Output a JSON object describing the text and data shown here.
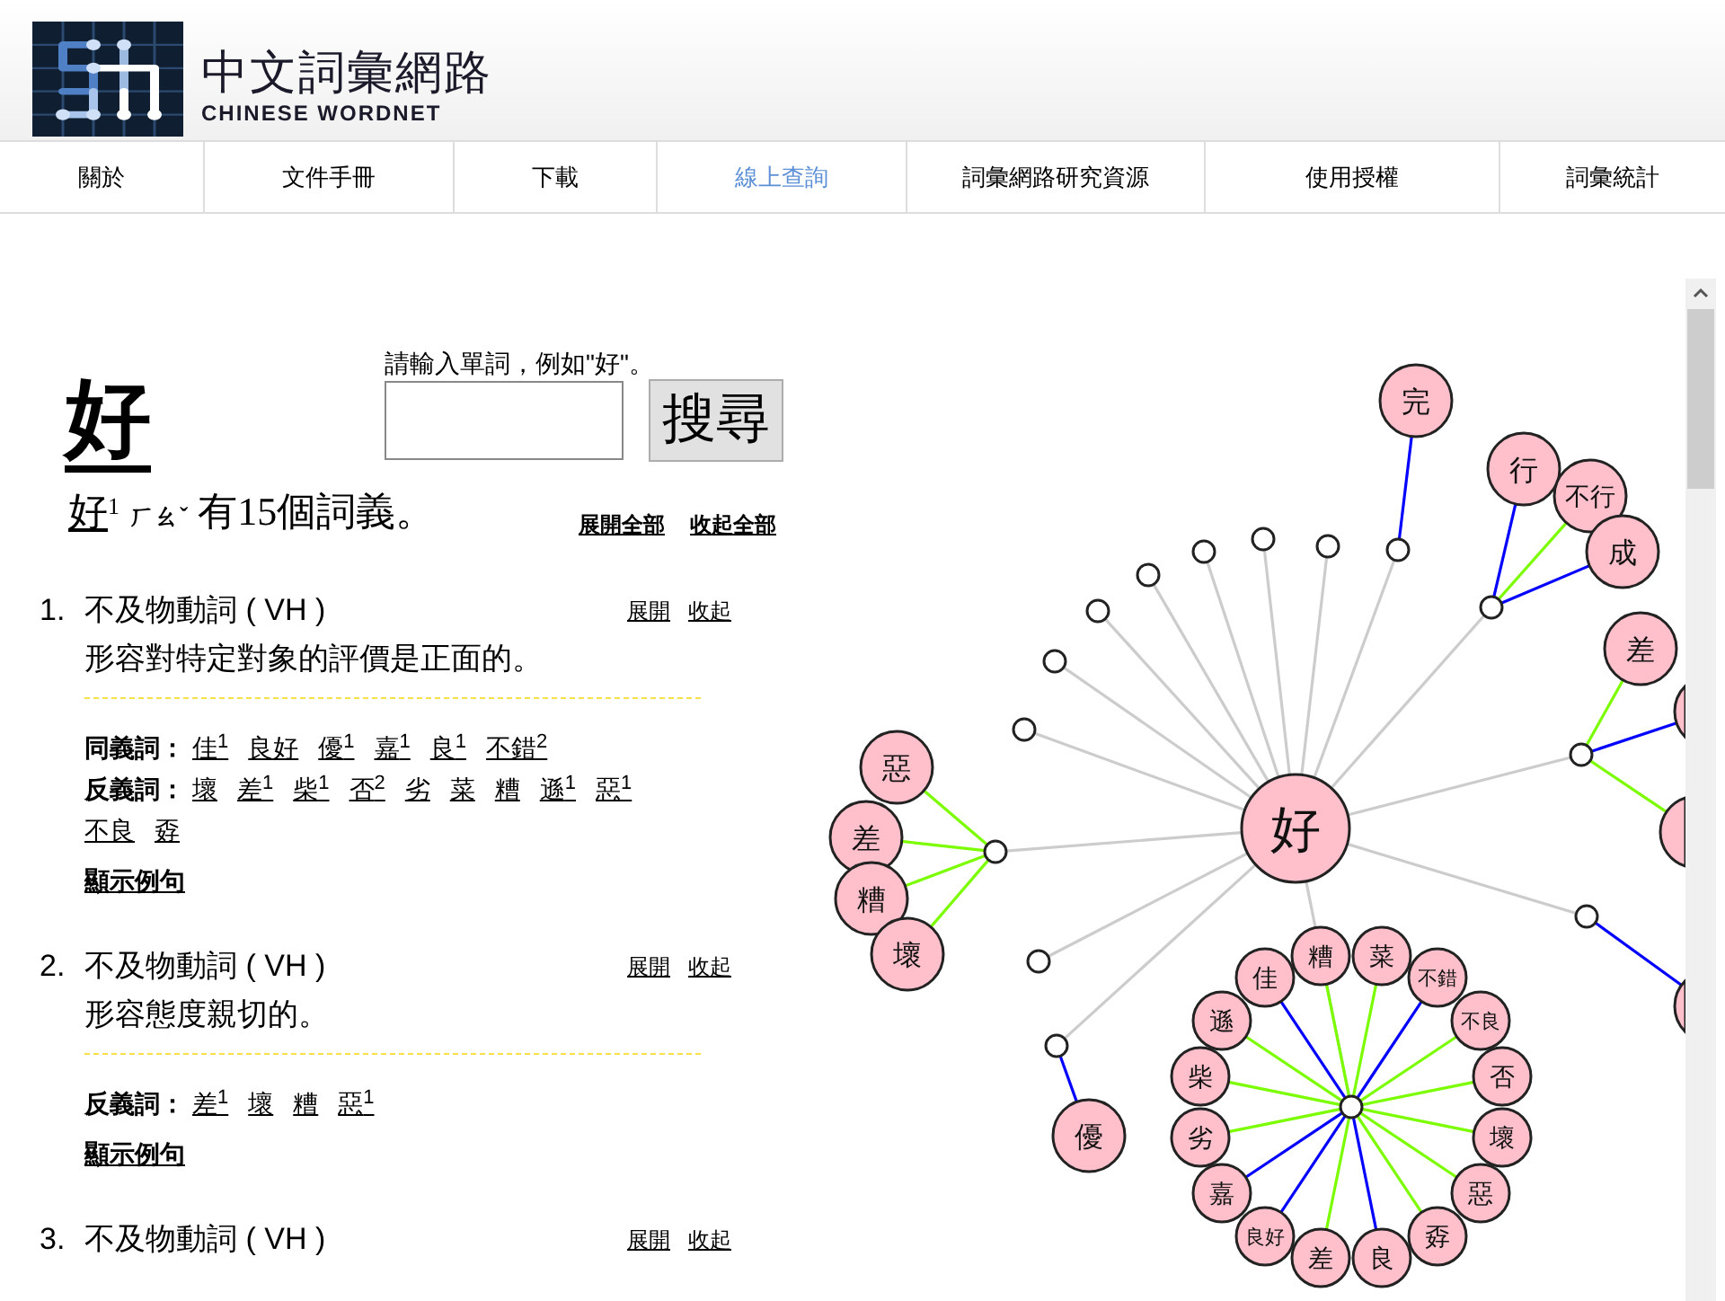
{
  "site": {
    "title": "中文詞彙網路",
    "subtitle": "CHINESE WORDNET"
  },
  "nav": [
    {
      "label": "關於",
      "selected": false
    },
    {
      "label": "文件手冊",
      "selected": false
    },
    {
      "label": "下載",
      "selected": false
    },
    {
      "label": "線上查詢",
      "selected": true
    },
    {
      "label": "詞彙網路研究資源",
      "selected": false
    },
    {
      "label": "使用授權",
      "selected": false
    },
    {
      "label": "詞彙統計",
      "selected": false
    }
  ],
  "search": {
    "prompt": "請輸入單詞，例如\"好\"。",
    "button": "搜尋"
  },
  "headword": "好",
  "summary": {
    "word": "好",
    "sup": "1",
    "zhuyin": "ㄏㄠˇ",
    "text": "有15個詞義。",
    "expand_all": "展開全部",
    "collapse_all": "收起全部"
  },
  "senses": [
    {
      "number": "1.",
      "pos": "不及物動詞 ( VH )",
      "definition": "形容對特定對象的評價是正面的。",
      "expand": "展開",
      "collapse": "收起",
      "relations": [
        {
          "label": "同義詞：",
          "words": [
            "佳$^{1}$",
            "良好",
            "優$^{1}$",
            "嘉$^{1}$",
            "良$^{1}$",
            "不錯$^{2}$"
          ]
        },
        {
          "label": "反義詞：",
          "words": [
            "壞",
            "差$^{1}$",
            "柴$^{1}$",
            "否$^{2}$",
            "劣",
            "菜",
            "糟",
            "遜$^{1}$",
            "惡$^{1}$",
            "不良",
            "孬"
          ]
        }
      ],
      "examples": "顯示例句"
    },
    {
      "number": "2.",
      "pos": "不及物動詞 ( VH )",
      "definition": "形容態度親切的。",
      "expand": "展開",
      "collapse": "收起",
      "relations": [
        {
          "label": "反義詞：",
          "words": [
            "差$^{1}$",
            "壞",
            "糟",
            "惡$^{1}$"
          ]
        }
      ],
      "examples": "顯示例句"
    },
    {
      "number": "3.",
      "pos": "不及物動詞 ( VH )",
      "expand": "展開",
      "collapse": "收起"
    }
  ],
  "graph": {
    "center": "好",
    "hubs": [
      {
        "words": [
          {
            "label": "完",
            "color": "#0000ff"
          }
        ]
      },
      {
        "words": [
          {
            "label": "行",
            "color": "#0000ff"
          },
          {
            "label": "不行",
            "color": "#7cfc00"
          },
          {
            "label": "成",
            "color": "#0000ff"
          }
        ]
      },
      {
        "words": [
          {
            "label": "差",
            "color": "#7cfc00"
          },
          {
            "color": "#0000ff"
          },
          {
            "color": "#7cfc00"
          }
        ]
      },
      {
        "words": [
          {
            "label": "惡",
            "color": "#7cfc00"
          },
          {
            "label": "差",
            "color": "#7cfc00"
          },
          {
            "label": "糟",
            "color": "#7cfc00"
          },
          {
            "label": "壞",
            "color": "#7cfc00"
          }
        ]
      },
      {
        "words": [
          {
            "label": "優",
            "color": "#0000ff"
          }
        ]
      },
      {
        "words": [
          {
            "label": "糟",
            "color": "#7cfc00"
          },
          {
            "label": "菜",
            "color": "#7cfc00"
          },
          {
            "label": "佳",
            "color": "#0000ff"
          },
          {
            "label": "不錯",
            "color": "#0000ff"
          },
          {
            "label": "遜",
            "color": "#7cfc00"
          },
          {
            "label": "不良",
            "color": "#7cfc00"
          },
          {
            "label": "柴",
            "color": "#7cfc00"
          },
          {
            "label": "否",
            "color": "#7cfc00"
          },
          {
            "label": "劣",
            "color": "#7cfc00"
          },
          {
            "label": "壞",
            "color": "#7cfc00"
          },
          {
            "label": "嘉",
            "color": "#0000ff"
          },
          {
            "label": "惡",
            "color": "#7cfc00"
          },
          {
            "label": "良好",
            "color": "#0000ff"
          },
          {
            "label": "孬",
            "color": "#7cfc00"
          },
          {
            "label": "差",
            "color": "#7cfc00"
          },
          {
            "label": "良",
            "color": "#0000ff"
          }
        ]
      },
      {
        "words": [
          {
            "color": "#0000ff"
          }
        ]
      }
    ]
  }
}
